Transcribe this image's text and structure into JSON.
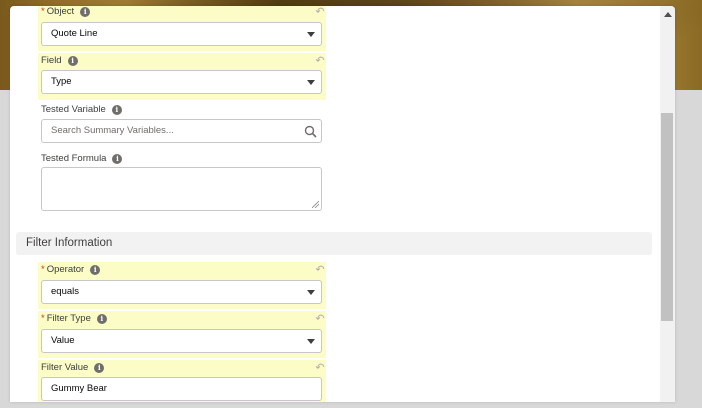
{
  "form": {
    "object": {
      "label": "Object",
      "value": "Quote Line"
    },
    "field": {
      "label": "Field",
      "value": "Type"
    },
    "tested_variable": {
      "label": "Tested Variable",
      "placeholder": "Search Summary Variables..."
    },
    "tested_formula": {
      "label": "Tested Formula",
      "value": ""
    }
  },
  "filter_section": {
    "title": "Filter Information",
    "operator": {
      "label": "Operator",
      "value": "equals"
    },
    "filter_type": {
      "label": "Filter Type",
      "value": "Value"
    },
    "filter_value": {
      "label": "Filter Value",
      "value": "Gummy Bear"
    }
  },
  "icons": {
    "required_marker": "*",
    "info": "i",
    "undo": "↶"
  },
  "colors": {
    "required_highlight": "#fbfcc6",
    "section_header_bg": "#f3f2f2"
  }
}
